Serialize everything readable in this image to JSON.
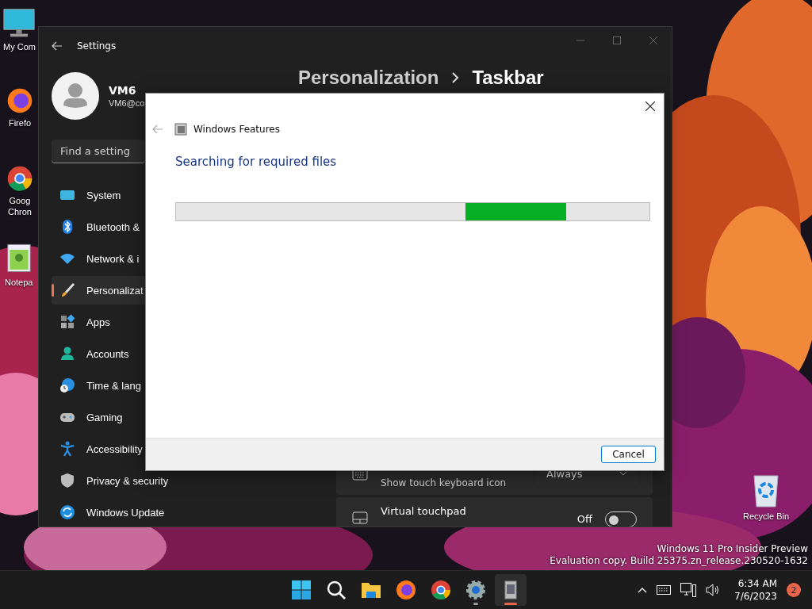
{
  "desktop": {
    "icons": [
      {
        "kind": "computer",
        "lines": [
          "My Com"
        ]
      },
      {
        "kind": "firefox",
        "lines": [
          "Firefo"
        ]
      },
      {
        "kind": "chrome",
        "lines": [
          "Goog",
          "Chron"
        ]
      },
      {
        "kind": "notepad",
        "lines": [
          "Notepa"
        ]
      }
    ],
    "recycle_bin": {
      "label": "Recycle Bin"
    },
    "watermark": [
      "Windows 11 Pro Insider Preview",
      "Evaluation copy. Build 25375.zn_release.230520-1632"
    ]
  },
  "settings_window": {
    "title": "Settings",
    "user": {
      "name": "VM6",
      "email": "VM6@co"
    },
    "search": {
      "placeholder": "Find a setting"
    },
    "nav": [
      {
        "kind": "system",
        "label": "System",
        "selected": false
      },
      {
        "kind": "bluetooth",
        "label": "Bluetooth &",
        "selected": false
      },
      {
        "kind": "network",
        "label": "Network & i",
        "selected": false
      },
      {
        "kind": "brush",
        "label": "Personalizat",
        "selected": true
      },
      {
        "kind": "apps",
        "label": "Apps",
        "selected": false
      },
      {
        "kind": "accounts",
        "label": "Accounts",
        "selected": false
      },
      {
        "kind": "time",
        "label": "Time & lang",
        "selected": false
      },
      {
        "kind": "gaming",
        "label": "Gaming",
        "selected": false
      },
      {
        "kind": "accessibility",
        "label": "Accessibility",
        "selected": false
      },
      {
        "kind": "privacy",
        "label": "Privacy & security",
        "selected": false
      },
      {
        "kind": "update",
        "label": "Windows Update",
        "selected": false
      }
    ],
    "breadcrumb": [
      "Personalization",
      "Taskbar"
    ],
    "rows": [
      {
        "kind": "dropdown",
        "subtitle": "Show touch keyboard icon",
        "value": "Always"
      },
      {
        "kind": "toggle",
        "title": "Virtual touchpad",
        "state_label": "Off",
        "on": false
      }
    ]
  },
  "dialog": {
    "title": "Windows Features",
    "heading": "Searching for required files",
    "buttons": [
      "Cancel"
    ]
  },
  "taskbar": {
    "apps": [
      {
        "kind": "start",
        "running": false,
        "selected": false
      },
      {
        "kind": "search",
        "running": false,
        "selected": false
      },
      {
        "kind": "explorer",
        "running": false,
        "selected": false
      },
      {
        "kind": "firefox",
        "running": false,
        "selected": false
      },
      {
        "kind": "chrome",
        "running": false,
        "selected": false
      },
      {
        "kind": "settings",
        "running": true,
        "selected": false
      },
      {
        "kind": "features",
        "running": true,
        "selected": true
      }
    ],
    "clock": {
      "time": "6:34 AM",
      "date": "7/6/2023"
    },
    "notifications": "2"
  }
}
